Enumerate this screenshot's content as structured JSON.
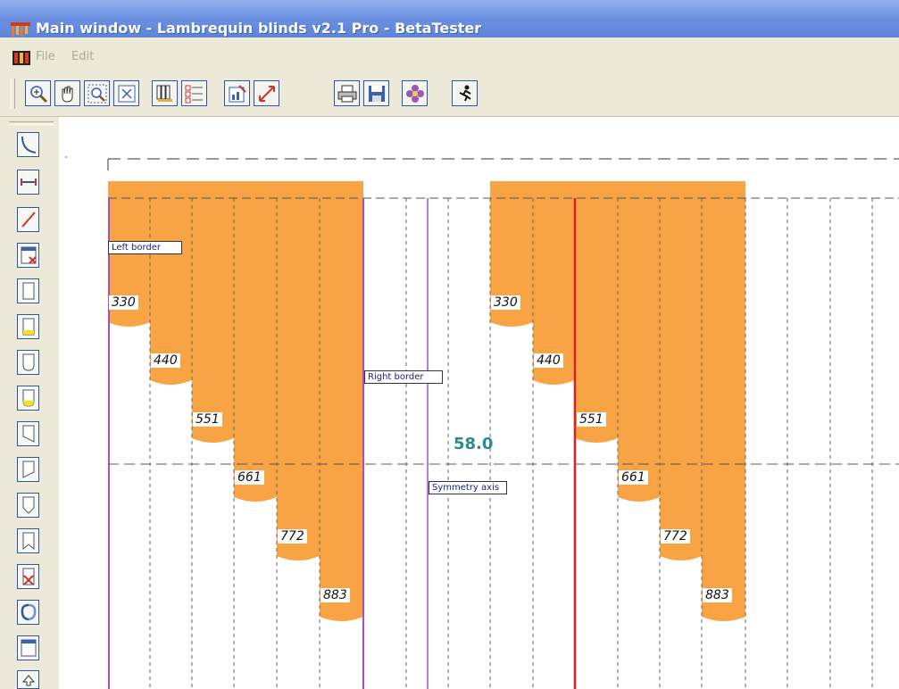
{
  "window": {
    "title": "Main window - Lambrequin blinds v2.1 Pro  -  BetaTester"
  },
  "menu": {
    "file": "File",
    "edit": "Edit"
  },
  "toolbar": {
    "buttons": [
      "zoom-in",
      "pan-hand",
      "zoom-window",
      "zoom-fit",
      "blinds",
      "steps-list",
      "edit-chart",
      "resize",
      "print",
      "save",
      "flower",
      "runner"
    ]
  },
  "tools": {
    "buttons": [
      "curve",
      "horizontal-line",
      "diagonal-line",
      "delete-rect",
      "rect",
      "rect-yellow",
      "rounded",
      "rounded-yellow",
      "bevel-left",
      "bevel-right",
      "pointed",
      "ribbon",
      "delete-x",
      "symmetry",
      "window",
      "up-arrow"
    ]
  },
  "drawing": {
    "labels": {
      "left_border": "Left border",
      "right_border": "Right border",
      "symmetry_axis": "Symmetry axis"
    },
    "center_value": "58.0",
    "left_group": [
      "330",
      "440",
      "551",
      "661",
      "772",
      "883"
    ],
    "right_group": [
      "330",
      "440",
      "551",
      "661",
      "772",
      "883"
    ],
    "colors": {
      "fill": "#f8a445",
      "border_line": "#a64fc9",
      "symmetry_line": "#b47fdc",
      "red_line": "#e21f1f",
      "dimension_text": "#2b8b86"
    }
  }
}
